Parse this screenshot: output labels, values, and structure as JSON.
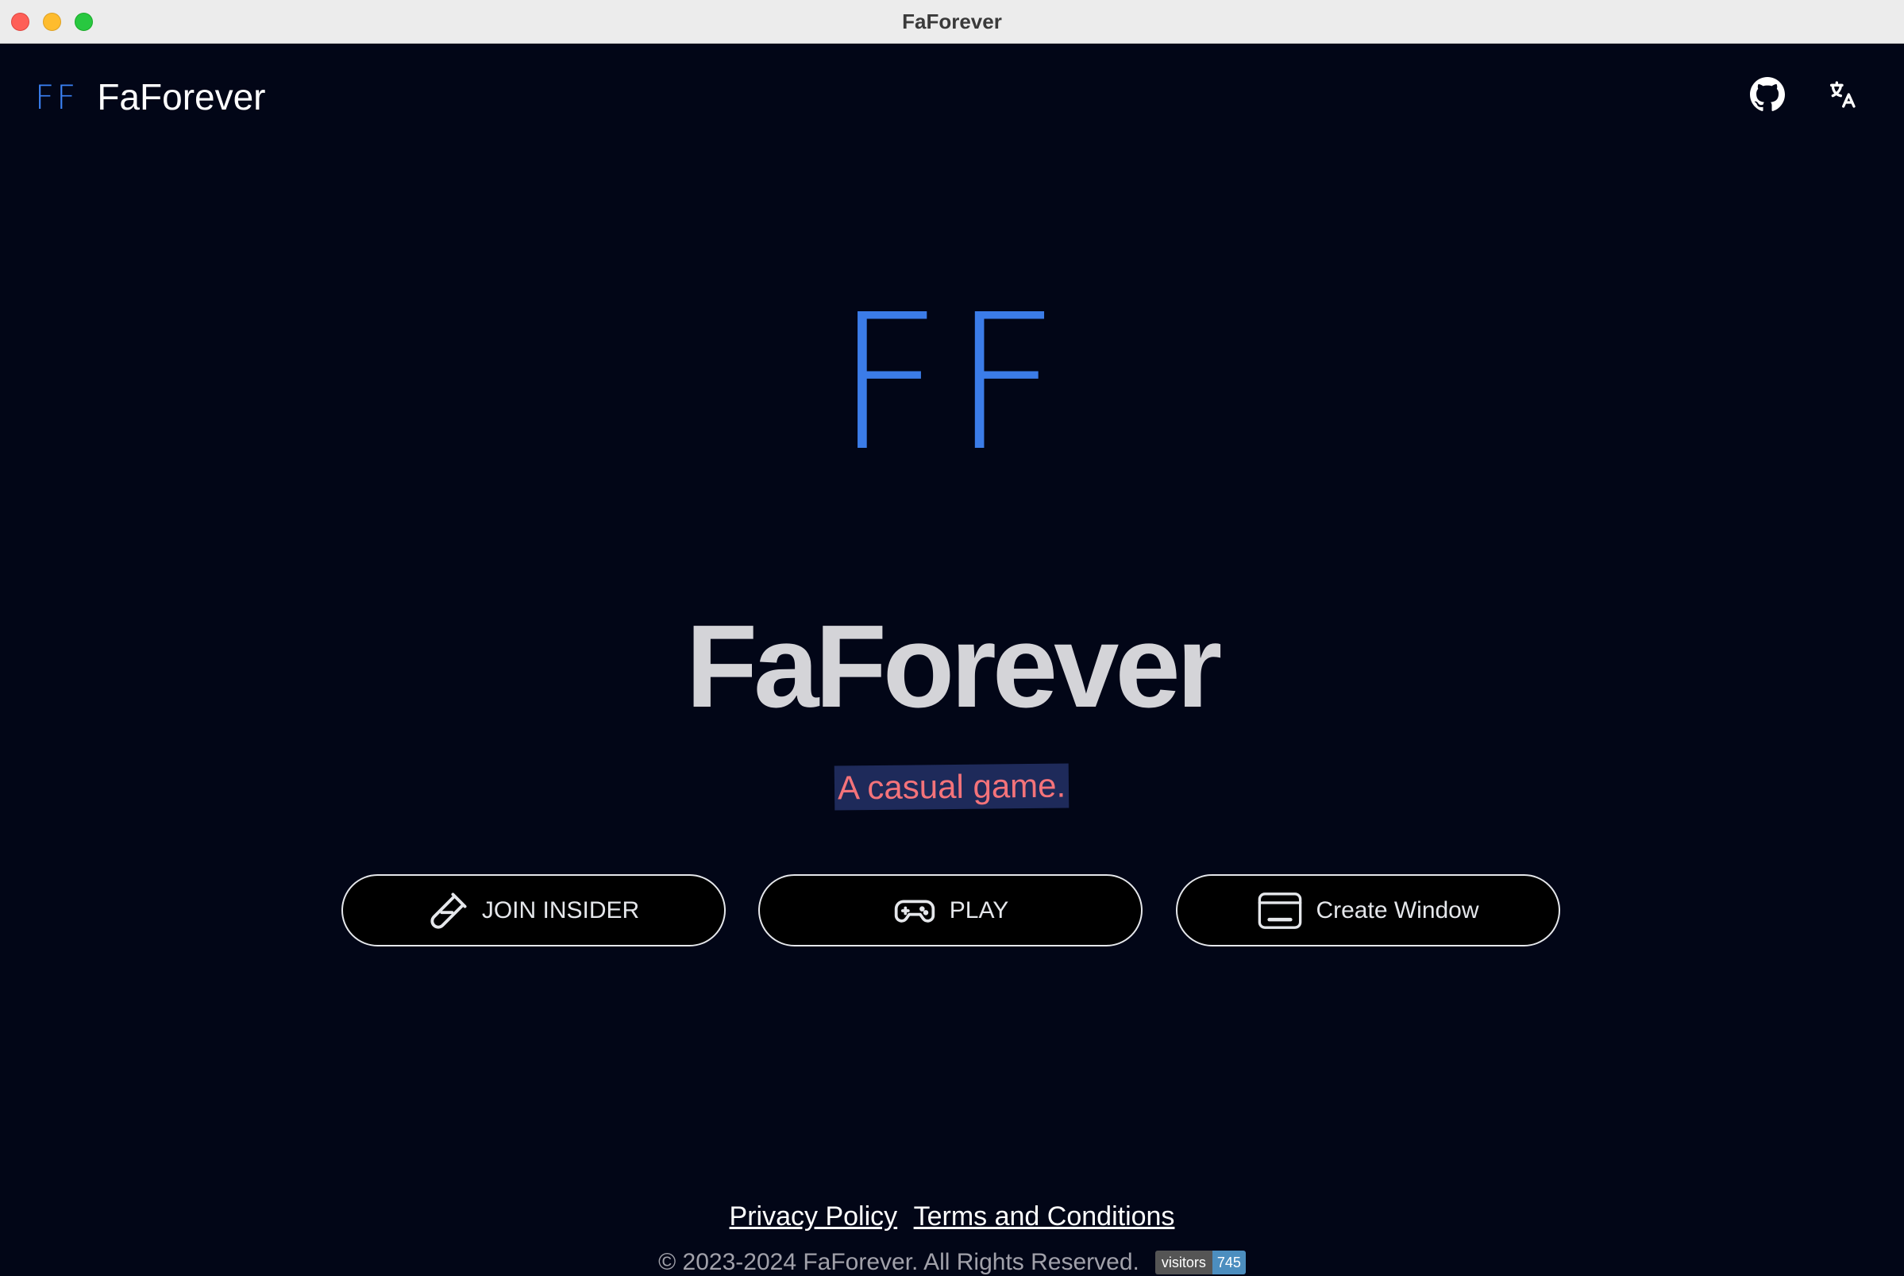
{
  "window": {
    "title": "FaForever"
  },
  "nav": {
    "logo": "FF",
    "brand": "FaForever",
    "github_icon": "github-icon",
    "translate_icon": "translate-icon"
  },
  "hero": {
    "logo": "FF",
    "title": "FaForever",
    "tagline": "A casual game."
  },
  "buttons": {
    "join_insider": "JOIN INSIDER",
    "play": "PLAY",
    "create_window": "Create Window"
  },
  "footer": {
    "privacy": "Privacy Policy",
    "terms": "Terms and Conditions",
    "copyright": "© 2023-2024 FaForever. All Rights Reserved.",
    "visitors_label": "visitors",
    "visitors_count": "745"
  },
  "colors": {
    "accent": "#3b82f6",
    "background": "#020617",
    "tagline": "#f4737a"
  }
}
